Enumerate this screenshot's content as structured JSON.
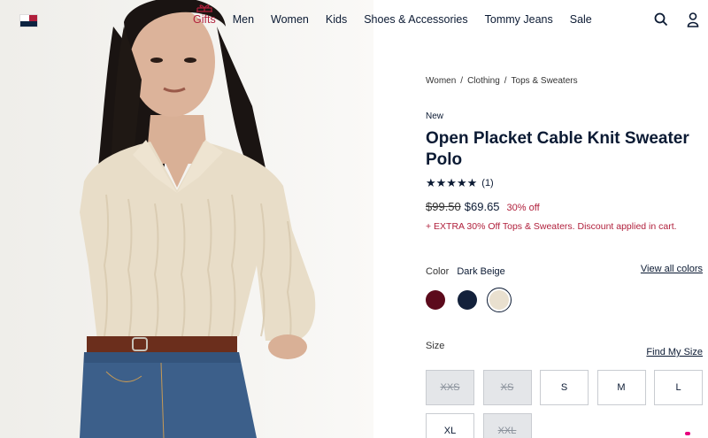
{
  "nav": {
    "items": [
      "Gifts",
      "Men",
      "Women",
      "Kids",
      "Shoes & Accessories",
      "Tommy Jeans",
      "Sale"
    ]
  },
  "header": {
    "search_icon": "search-icon",
    "account_icon": "user-icon"
  },
  "breadcrumb": [
    "Women",
    "Clothing",
    "Tops & Sweaters"
  ],
  "product": {
    "badge": "New",
    "title": "Open Placket Cable Knit Sweater Polo",
    "rating_count": "(1)",
    "rating_value": 5,
    "old_price": "$99.50",
    "price": "$69.65",
    "discount": "30% off",
    "promo": "+ EXTRA 30% Off Tops & Sweaters. Discount applied in cart."
  },
  "color": {
    "label": "Color",
    "selected": "Dark Beige",
    "view_all": "View all colors",
    "swatches": [
      "#5c0a1c",
      "#13213b",
      "#e9e0cf"
    ]
  },
  "size": {
    "label": "Size",
    "find_my_size": "Find My Size",
    "options": [
      {
        "label": "XXS",
        "available": false
      },
      {
        "label": "XS",
        "available": false
      },
      {
        "label": "S",
        "available": true
      },
      {
        "label": "M",
        "available": true
      },
      {
        "label": "L",
        "available": true
      },
      {
        "label": "XL",
        "available": true
      },
      {
        "label": "XXL",
        "available": false
      }
    ]
  },
  "colors": {
    "accent_red": "#b01f3b",
    "navy": "#0c2340"
  }
}
